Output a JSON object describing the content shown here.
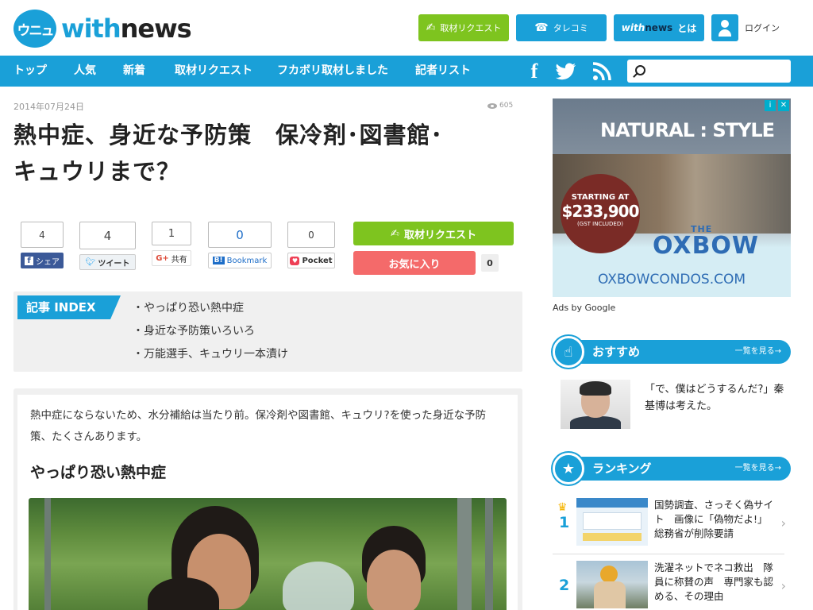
{
  "header": {
    "logo_mark": "ウニュ",
    "logo_with": "with",
    "logo_news": "news",
    "btn_request": "取材リクエスト",
    "btn_tarekomi": "タレコミ",
    "btn_about_with": "with",
    "btn_about_news": "news",
    "btn_about_suffix": "とは",
    "login": "ログイン"
  },
  "nav": {
    "items": [
      "トップ",
      "人気",
      "新着",
      "取材リクエスト",
      "フカボリ取材しました",
      "記者リスト"
    ],
    "search_placeholder": ""
  },
  "article": {
    "date": "2014年07月24日",
    "views": "605",
    "title_line1": "熱中症、身近な予防策　保冷剤･図書館･",
    "title_line2": "キュウリまで？",
    "share": {
      "facebook": {
        "count": "4",
        "label": "シェア"
      },
      "twitter": {
        "count": "4",
        "label": "ツイート"
      },
      "googleplus": {
        "count": "1",
        "label": "共有"
      },
      "hatena": {
        "count": "0",
        "label": "Bookmark"
      },
      "pocket": {
        "count": "0",
        "label": "Pocket"
      }
    },
    "request_button": "取材リクエスト",
    "favorite_button": "お気に入り",
    "favorite_count": "0",
    "index_label": "記事 INDEX",
    "index_items": [
      "・やっぱり恐い熱中症",
      "・身近な予防策いろいろ",
      "・万能選手、キュウリ一本漬け"
    ],
    "lead": "熱中症にならないため、水分補給は当たり前。保冷剤や図書館、キュウリ?を使った身近な予防策、たくさんあります。",
    "section_heading": "やっぱり恐い熱中症"
  },
  "sidebar": {
    "ad": {
      "title": "NATURAL : STYLE",
      "starting_at": "STARTING AT",
      "price": "$233,900",
      "gst": "(GST INCLUDED)",
      "brand_small": "THE",
      "brand": "OXBOW",
      "url": "OXBOWCONDOS.COM",
      "ads_by": "Ads by Google"
    },
    "recommend": {
      "label": "おすすめ",
      "more": "一覧を見る→",
      "item_text": "「で、僕はどうするんだ?」秦 基博は考えた。"
    },
    "ranking": {
      "label": "ランキング",
      "more": "一覧を見る→",
      "items": [
        {
          "num": "1",
          "text": "国勢調査、さっそく偽サイト　画像に「偽物だよ!」総務省が削除要請"
        },
        {
          "num": "2",
          "text": "洗濯ネットでネコ救出　隊員に称賛の声　専門家も認める、その理由"
        }
      ]
    }
  },
  "colors": {
    "brand_blue": "#1aa0d8",
    "request_green": "#7ec41f",
    "favorite_red": "#f46a6a",
    "facebook_blue": "#3b5998"
  }
}
